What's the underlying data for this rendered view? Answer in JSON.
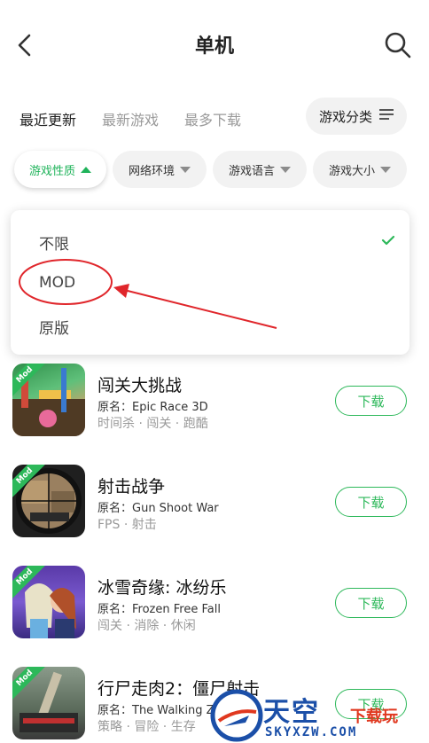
{
  "header": {
    "title": "单机",
    "back_icon": "back-arrow-icon",
    "search_icon": "search-icon"
  },
  "tabs": [
    {
      "label": "最近更新",
      "active": true
    },
    {
      "label": "最新游戏",
      "active": false
    },
    {
      "label": "最多下载",
      "active": false
    }
  ],
  "category_button": {
    "label": "游戏分类",
    "icon": "filter-lines-icon"
  },
  "filters": [
    {
      "label": "游戏性质",
      "active": true
    },
    {
      "label": "网络环境",
      "active": false
    },
    {
      "label": "游戏语言",
      "active": false
    },
    {
      "label": "游戏大小",
      "active": false
    }
  ],
  "dropdown": {
    "options": [
      {
        "label": "不限",
        "selected": true
      },
      {
        "label": "MOD",
        "selected": false
      },
      {
        "label": "原版",
        "selected": false
      }
    ]
  },
  "games": [
    {
      "name": "闯关大挑战",
      "original": "原名：Epic Race 3D",
      "tags": "时间杀 · 闯关 · 跑酷",
      "badge": "Mod",
      "button": "下载"
    },
    {
      "name": "射击战争",
      "original": "原名：Gun Shoot War",
      "tags": "FPS · 射击",
      "badge": "Mod",
      "button": "下载"
    },
    {
      "name": "冰雪奇缘: 冰纷乐",
      "original": "原名：Frozen Free Fall",
      "tags": "闯关 · 消除 · 休闲",
      "badge": "Mod",
      "button": "下载"
    },
    {
      "name": "行尸走肉2：僵尸射击",
      "original": "原名：The Walking Z",
      "tags": "策略 · 冒险 · 生存",
      "badge": "Mod",
      "button": "下载"
    }
  ],
  "watermark": {
    "brand": "天空",
    "sub": "下载玩",
    "url": "SKYXZW.COM"
  },
  "colors": {
    "accent": "#2db85a",
    "annotation": "#e0262b",
    "watermark_blue": "#1b4fa8"
  }
}
